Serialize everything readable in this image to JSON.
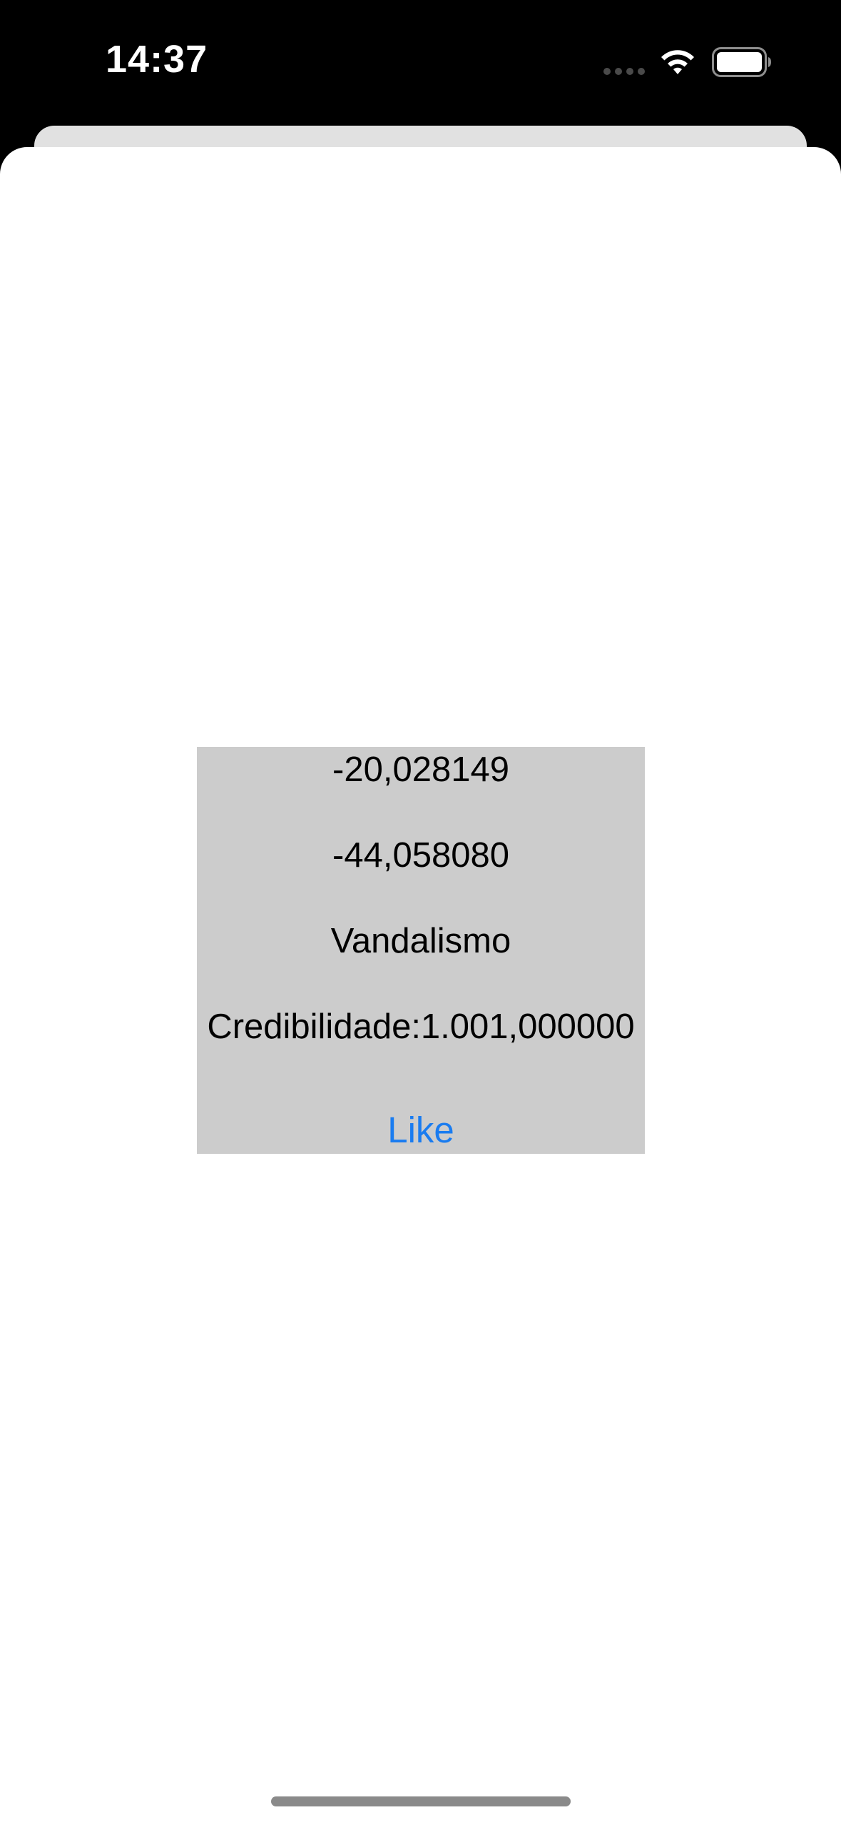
{
  "status_bar": {
    "time": "14:37",
    "icons": [
      "signal-dots-icon",
      "wifi-icon",
      "battery-icon"
    ]
  },
  "info_card": {
    "latitude": "-20,028149",
    "longitude": "-44,058080",
    "category": "Vandalismo",
    "credibility": "Credibilidade:1.001,000000",
    "like_label": "Like"
  },
  "colors": {
    "status_bar_bg": "#000000",
    "sheet_bg": "#ffffff",
    "back_card_bg": "#e1e1e1",
    "info_box_bg": "#cccccc",
    "link_accent": "#1a7cf0",
    "home_indicator": "#8a8a8a"
  }
}
